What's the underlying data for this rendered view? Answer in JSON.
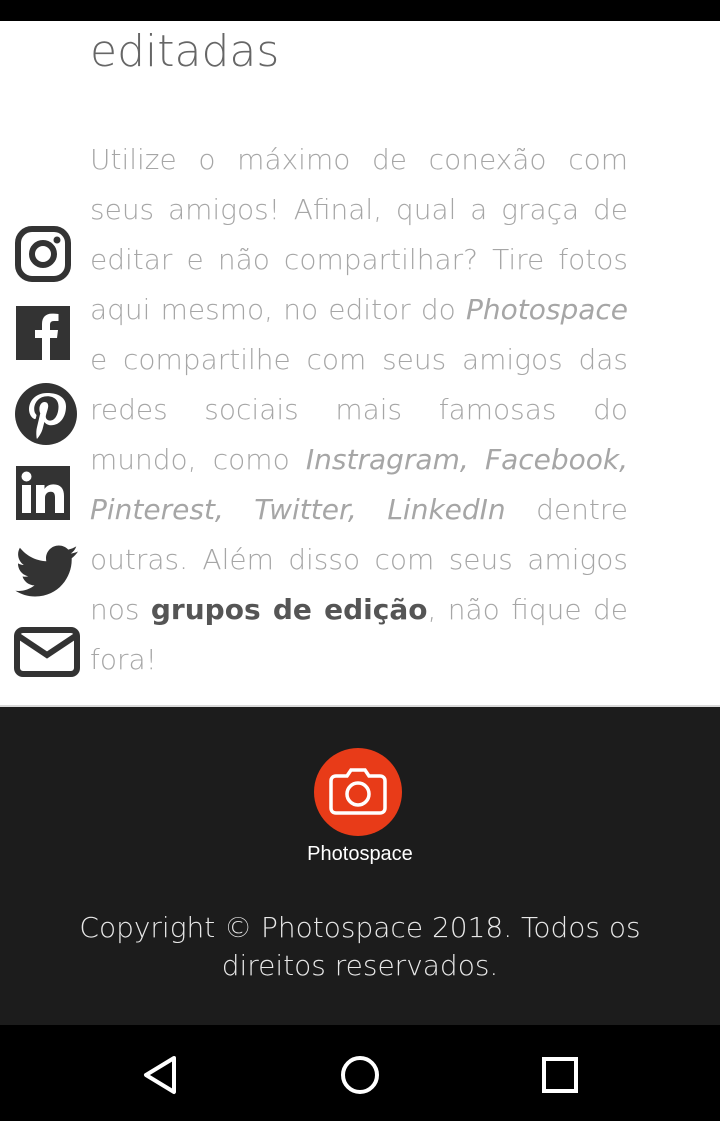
{
  "article": {
    "heading": "editadas",
    "p1": "Utilize o máximo de conexão com seus amigos! Afinal, qual a graça de editar e não compartilhar? Tire fotos aqui mesmo, no editor do ",
    "brand_em": "Photospace",
    "p2": " e compartilhe com seus amigos das redes sociais mais famosas do mundo, como ",
    "networks_em": "Instragram, Facebook, Pinterest, Twitter, LinkedIn",
    "p3": " dentre outras. Além disso com seus amigos nos ",
    "groups_link": "grupos de edição",
    "p4": ", não fique de fora!"
  },
  "social": {
    "icons": [
      "instagram-icon",
      "facebook-icon",
      "pinterest-icon",
      "linkedin-icon",
      "twitter-icon",
      "mail-icon"
    ],
    "icon_color": "#333333"
  },
  "footer": {
    "logo_text": "Photospace",
    "copyright": "Copyright © Photospace 2018. Todos os direitos reservados.",
    "brand_color": "#e83b18",
    "background": "#1c1c1c"
  },
  "nav": {
    "buttons": [
      "back-icon",
      "home-icon",
      "recents-icon"
    ]
  }
}
